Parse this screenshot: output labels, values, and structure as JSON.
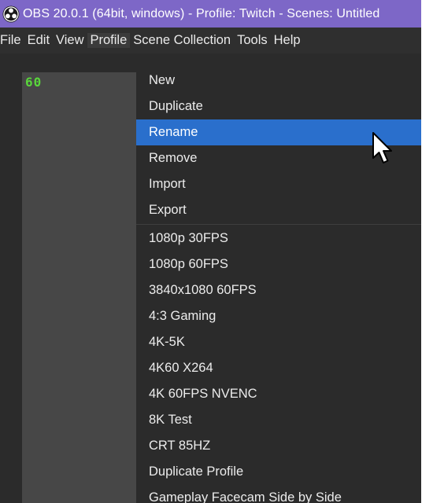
{
  "window": {
    "title": "OBS 20.0.1 (64bit, windows) - Profile: Twitch - Scenes: Untitled",
    "logo_icon": "obs-logo-icon"
  },
  "menubar": {
    "items": [
      "File",
      "Edit",
      "View",
      "Profile",
      "Scene Collection",
      "Tools",
      "Help"
    ],
    "open_menu": "Profile"
  },
  "stats": {
    "fps_readout": "60"
  },
  "profile_menu": {
    "actions": [
      "New",
      "Duplicate",
      "Rename",
      "Remove",
      "Import",
      "Export"
    ],
    "highlighted": "Rename",
    "profiles": [
      "1080p 30FPS",
      "1080p 60FPS",
      "3840x1080 60FPS",
      "4:3 Gaming",
      "4K-5K",
      "4K60 X264",
      "4K 60FPS NVENC",
      "8K Test",
      "CRT 85HZ",
      "Duplicate Profile",
      "Gameplay Facecam Side by Side"
    ]
  },
  "colors": {
    "titlebar": "#7d67c7",
    "highlight": "#2a6fcc",
    "menu_bg": "#2b2b2b",
    "fps_text": "#59d63b"
  },
  "cursor_icon": "mouse-pointer-icon"
}
